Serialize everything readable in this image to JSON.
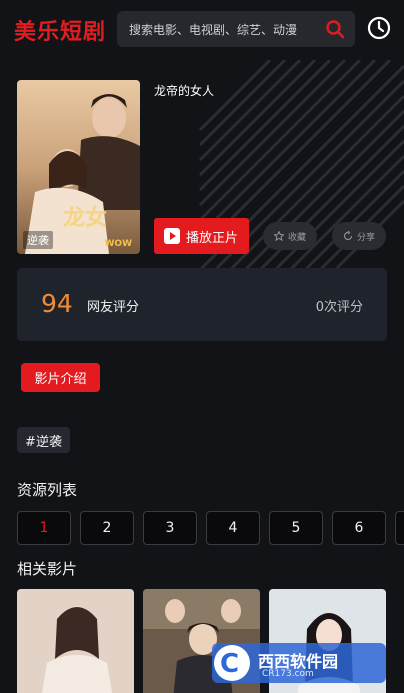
{
  "header": {
    "logo": "美乐短剧",
    "search_placeholder": "搜索电影、电视剧、综艺、动漫",
    "search_icon": "search-icon",
    "history_icon": "clock-icon"
  },
  "movie": {
    "title": "龙帝的女人",
    "poster_tag": "逆袭",
    "poster_mark": "WOW",
    "play_label": "播放正片",
    "fav_label": "收藏",
    "share_label": "分享"
  },
  "rating": {
    "score": "94",
    "label": "网友评分",
    "count": "0次评分"
  },
  "intro_label": "影片介绍",
  "tag": "#逆袭",
  "sources": {
    "title": "资源列表",
    "episodes": [
      "1",
      "2",
      "3",
      "4",
      "5",
      "6"
    ],
    "active": "1"
  },
  "related": {
    "title": "相关影片"
  },
  "watermark": {
    "text": "西西软件园",
    "sub": "CR173.com"
  },
  "colors": {
    "accent": "#e31b1f",
    "score": "#f08a36",
    "background": "#121316"
  }
}
